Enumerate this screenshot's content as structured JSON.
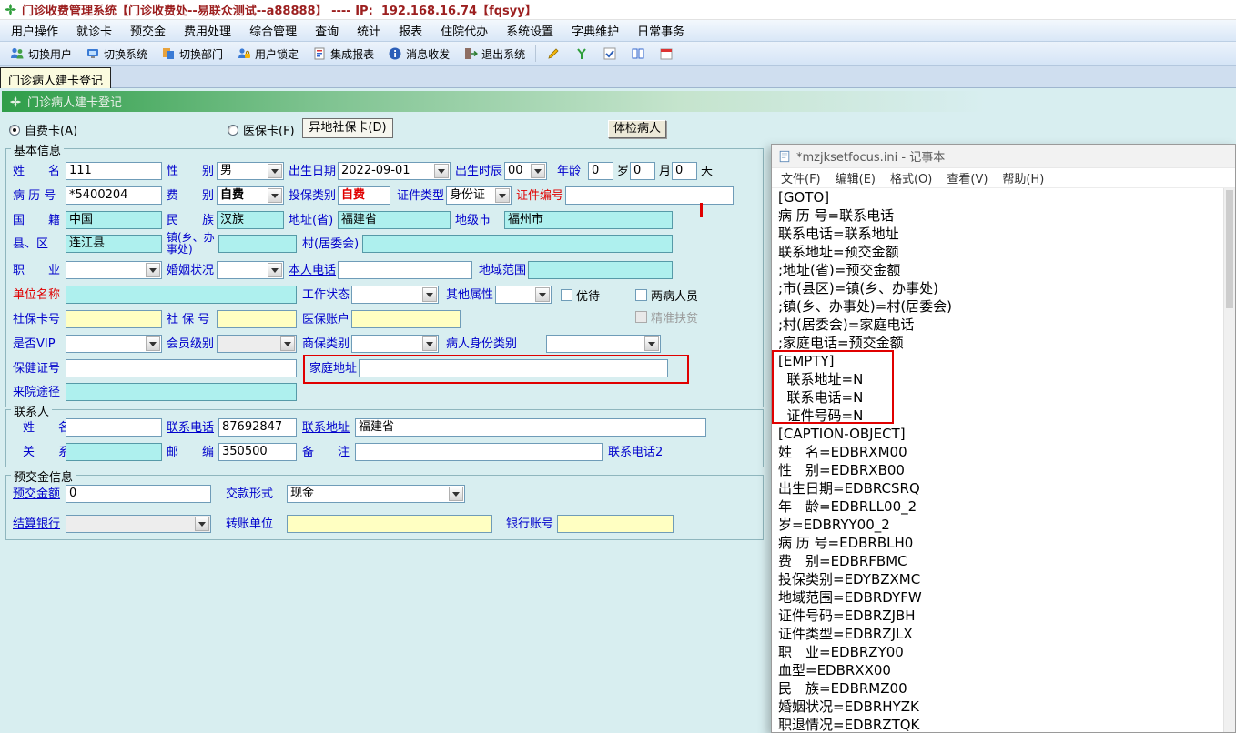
{
  "titlebar": {
    "title": "门诊收费管理系统【门诊收费处--易联众测试--a88888】 ---- IP:  192.168.16.74【fqsyy】"
  },
  "menubar": {
    "items": [
      "用户操作",
      "就诊卡",
      "预交金",
      "费用处理",
      "综合管理",
      "查询",
      "统计",
      "报表",
      "住院代办",
      "系统设置",
      "字典维护",
      "日常事务"
    ]
  },
  "toolbar": {
    "labels": [
      "切换用户",
      "切换系统",
      "切换部门",
      "用户锁定",
      "集成报表",
      "消息收发",
      "退出系统"
    ]
  },
  "tabs": {
    "active": "门诊病人建卡登记"
  },
  "header": {
    "title": "门诊病人建卡登记"
  },
  "cardtype": {
    "selfpay": "自费卡(A)",
    "medicare": "医保卡(F)",
    "remote": "异地社保卡(D)",
    "checkup": "体检病人"
  },
  "basic": {
    "section": "基本信息",
    "name_label": "姓　　名",
    "name": "111",
    "gender_label": "性　　别",
    "gender": "男",
    "birthdate_label": "出生日期",
    "birthdate": "2022-09-01",
    "birthhour_label": "出生时辰",
    "birthhour": "00",
    "age_label": "年龄",
    "age_y": "0",
    "unit_y": "岁",
    "age_m": "0",
    "unit_m": "月",
    "age_d": "0",
    "unit_d": "天",
    "mrn_label": "病 历 号",
    "mrn": "*5400204",
    "fee_label": "费　　别",
    "fee": "自费",
    "insure_label": "投保类别",
    "insure": "自费",
    "idtype_label": "证件类型",
    "idtype": "身份证",
    "idno_label": "证件编号",
    "idno": "",
    "nation_label": "国　　籍",
    "nation": "中国",
    "ethnic_label": "民　　族",
    "ethnic": "汉族",
    "province_label": "地址(省)",
    "province": "福建省",
    "city_label": "地级市",
    "city": "福州市",
    "county_label": "县、区",
    "county": "连江县",
    "town_label": "镇(乡、办事处)",
    "town": "",
    "village_label": "村(居委会)",
    "village": "",
    "job_label": "职　　业",
    "job": "",
    "marriage_label": "婚姻状况",
    "marriage": "",
    "phone_label": "本人电话",
    "phone": "",
    "region_label": "地域范围",
    "region": "",
    "employer_label": "单位名称",
    "employer": "",
    "workstate_label": "工作状态",
    "workstate": "",
    "otherattr_label": "其他属性",
    "otherattr": "",
    "youdai": "优待",
    "liangbing": "两病人员",
    "sscard_label": "社保卡号",
    "sscard": "",
    "ssno_label": "社 保 号",
    "ssno": "",
    "yibao_label": "医保账户",
    "yibao": "",
    "fupin": "精准扶贫",
    "vip_label": "是否VIP",
    "vip": "",
    "member_label": "会员级别",
    "member": "",
    "shangbao_label": "商保类别",
    "shangbao": "",
    "identity_label": "病人身份类别",
    "identity": "",
    "healthcert_label": "保健证号",
    "healthcert": "",
    "homeaddr_label": "家庭地址",
    "homeaddr": "",
    "source_label": "来院途径",
    "source": ""
  },
  "contact": {
    "section": "联系人",
    "name_label": "姓　　名",
    "name": "",
    "phone_label": "联系电话",
    "phone": "87692847",
    "addr_label": "联系地址",
    "addr": "福建省",
    "relation_label": "关　　系",
    "relation": "",
    "zip_label": "邮　　编",
    "zip": "350500",
    "note_label": "备　　注",
    "note": "",
    "phone2_label": "联系电话2"
  },
  "prepay": {
    "section": "预交金信息",
    "amount_label": "预交金额",
    "amount": "0",
    "payform_label": "交款形式",
    "payform": "现金",
    "bank_label": "结算银行",
    "bank": "",
    "transfer_label": "转账单位",
    "transfer": "",
    "account_label": "银行账号",
    "account": ""
  },
  "notepad": {
    "title": "*mzjksetfocus.ini - 记事本",
    "menu": [
      "文件(F)",
      "编辑(E)",
      "格式(O)",
      "查看(V)",
      "帮助(H)"
    ],
    "lines": [
      "[GOTO]",
      "病 历 号=联系电话",
      "联系电话=联系地址",
      "联系地址=预交金额",
      ";地址(省)=预交金额",
      ";市(县区)=镇(乡、办事处)",
      ";镇(乡、办事处)=村(居委会)",
      ";村(居委会)=家庭电话",
      ";家庭电话=预交金额",
      "[EMPTY]",
      "  联系地址=N",
      "  联系电话=N",
      "  证件号码=N",
      "[CAPTION-OBJECT]",
      "姓　名=EDBRXM00",
      "性　别=EDBRXB00",
      "出生日期=EDBRCSRQ",
      "年　龄=EDBRLL00_2",
      "岁=EDBRYY00_2",
      "病 历 号=EDBRBLH0",
      "费　别=EDBRFBMC",
      "投保类别=EDYBZXMC",
      "地域范围=EDBRDYFW",
      "证件号码=EDBRZJBH",
      "证件类型=EDBRZJLX",
      "职　业=EDBRZY00",
      "血型=EDBRXX00",
      "民　族=EDBRMZ00",
      "婚姻状况=EDBRHYZK",
      "职退情况=EDBRZTQK"
    ]
  }
}
